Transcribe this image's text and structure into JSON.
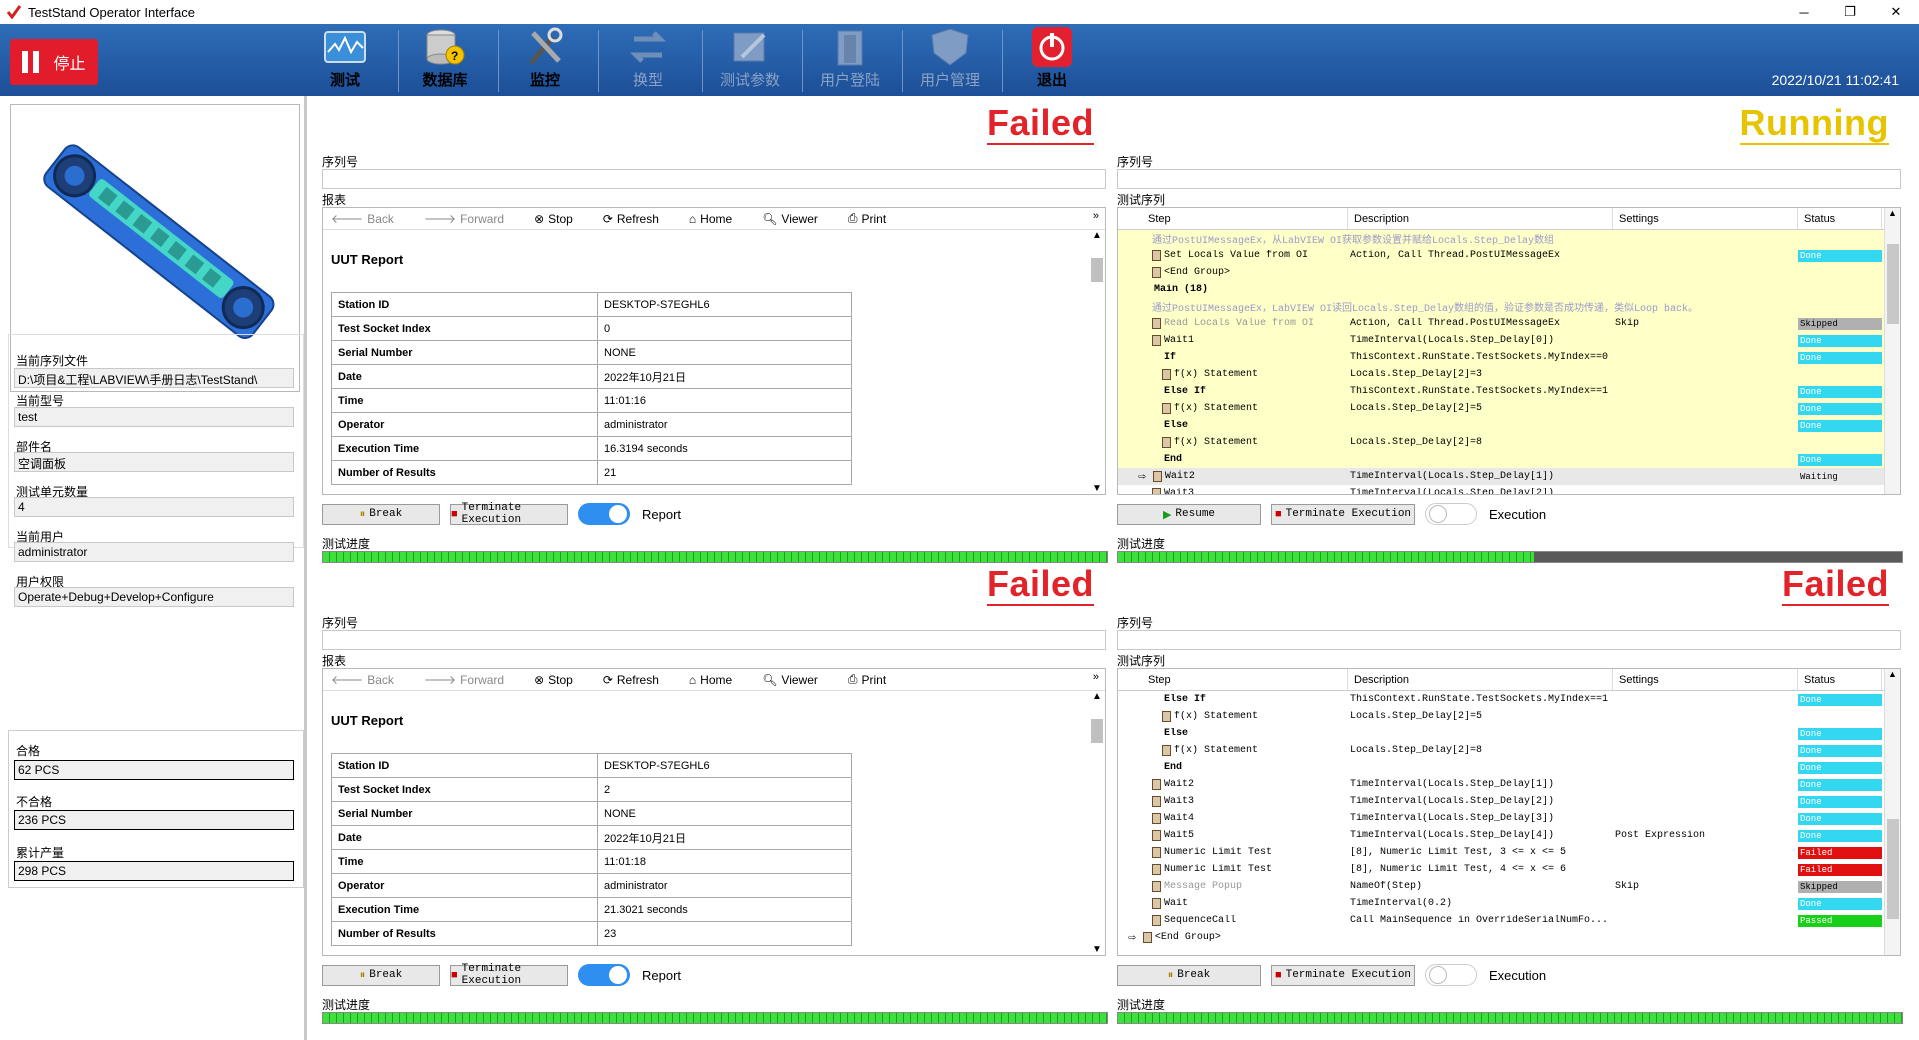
{
  "window": {
    "title": "TestStand Operator Interface",
    "min": "─",
    "max": "❐",
    "close": "✕"
  },
  "toolbar": {
    "stop": "停止",
    "items": [
      {
        "label": "测试",
        "enabled": true
      },
      {
        "label": "数据库",
        "enabled": true
      },
      {
        "label": "监控",
        "enabled": true
      },
      {
        "label": "换型",
        "enabled": false
      },
      {
        "label": "测试参数",
        "enabled": false
      },
      {
        "label": "用户登陆",
        "enabled": false
      },
      {
        "label": "用户管理",
        "enabled": false
      },
      {
        "label": "退出",
        "enabled": true
      }
    ],
    "datetime": "2022/10/21 11:02:41"
  },
  "left": {
    "seq_file_label": "当前序列文件",
    "seq_file": "D:\\项目&工程\\LABVIEW\\手册日志\\TestStand\\",
    "model_label": "当前型号",
    "model": "test",
    "part_label": "部件名",
    "part": "空调面板",
    "units_label": "测试单元数量",
    "units": "4",
    "user_label": "当前用户",
    "user": "administrator",
    "priv_label": "用户权限",
    "priv": "Operate+Debug+Develop+Configure",
    "pass_label": "合格",
    "pass": "62 PCS",
    "fail_label": "不合格",
    "fail": "236 PCS",
    "total_label": "累计产量",
    "total": "298 PCS"
  },
  "common": {
    "serial_label": "序列号",
    "report_label": "报表",
    "seq_label": "测试序列",
    "progress_label": "测试进度",
    "back": "Back",
    "forward": "Forward",
    "stop": "Stop",
    "refresh": "Refresh",
    "home": "Home",
    "viewer": "Viewer",
    "print": "Print",
    "break": "Break",
    "resume": "Resume",
    "terminate": "Terminate Execution",
    "report_toggle": "Report",
    "exec_toggle": "Execution",
    "uut_report": "UUT Report",
    "col_step": "Step",
    "col_desc": "Description",
    "col_settings": "Settings",
    "col_status": "Status"
  },
  "sockets": [
    {
      "status": "Failed",
      "progress": 1.0,
      "report": [
        [
          "Station ID",
          "DESKTOP-S7EGHL6"
        ],
        [
          "Test Socket Index",
          "0"
        ],
        [
          "Serial Number",
          "NONE"
        ],
        [
          "Date",
          "2022年10月21日"
        ],
        [
          "Time",
          "11:01:16"
        ],
        [
          "Operator",
          "administrator"
        ],
        [
          "Execution Time",
          "16.3194 seconds"
        ],
        [
          "Number of Results",
          "21"
        ]
      ]
    },
    {
      "status": "Running",
      "progress": 0.53
    },
    {
      "status": "Failed",
      "progress": 1.0,
      "report": [
        [
          "Station ID",
          "DESKTOP-S7EGHL6"
        ],
        [
          "Test Socket Index",
          "2"
        ],
        [
          "Serial Number",
          "NONE"
        ],
        [
          "Date",
          "2022年10月21日"
        ],
        [
          "Time",
          "11:01:18"
        ],
        [
          "Operator",
          "administrator"
        ],
        [
          "Execution Time",
          "21.3021 seconds"
        ],
        [
          "Number of Results",
          "23"
        ]
      ]
    },
    {
      "status": "Failed",
      "progress": 1.0
    }
  ],
  "seq2": [
    {
      "step": "通过PostUIMessageEx，从LabVIEW OI获取参数设置并赋给Locals.Step_Delay数组",
      "desc": "",
      "set": "",
      "status": "",
      "cls": "comment yel",
      "ind": 2
    },
    {
      "step": "Set Locals Value from OI",
      "desc": "Action,  Call Thread.PostUIMessageEx",
      "set": "",
      "status": "Done",
      "cls": "yel",
      "ind": 2
    },
    {
      "step": "<End Group>",
      "desc": "",
      "set": "",
      "status": "",
      "cls": "yel",
      "ind": 2
    },
    {
      "step": "Main (18)",
      "desc": "",
      "set": "",
      "status": "",
      "cls": "yel",
      "ind": 1,
      "bold": true
    },
    {
      "step": "通过PostUIMessageEx，LabVIEW OI读回Locals.Step_Delay数组的值，验证参数是否成功传递，类似Loop back。",
      "desc": "",
      "set": "",
      "status": "",
      "cls": "comment yel",
      "ind": 2
    },
    {
      "step": "Read Locals Value from OI",
      "desc": "Action,  Call Thread.PostUIMessageEx",
      "set": "Skip",
      "status": "Skipped",
      "cls": "yel",
      "ind": 2,
      "dim": true
    },
    {
      "step": "Wait1",
      "desc": "TimeInterval(Locals.Step_Delay[0])",
      "set": "",
      "status": "Done",
      "cls": "yel",
      "ind": 2
    },
    {
      "step": "If",
      "desc": "ThisContext.RunState.TestSockets.MyIndex==0",
      "set": "",
      "status": "Done",
      "cls": "yel",
      "ind": 2,
      "bold": true
    },
    {
      "step": "f(x) Statement",
      "desc": "Locals.Step_Delay[2]=3",
      "set": "",
      "status": "",
      "cls": "yel",
      "ind": 3
    },
    {
      "step": "Else If",
      "desc": "ThisContext.RunState.TestSockets.MyIndex==1",
      "set": "",
      "status": "Done",
      "cls": "yel",
      "ind": 2,
      "bold": true
    },
    {
      "step": "f(x) Statement",
      "desc": "Locals.Step_Delay[2]=5",
      "set": "",
      "status": "Done",
      "cls": "yel",
      "ind": 3
    },
    {
      "step": "Else",
      "desc": "",
      "set": "",
      "status": "Done",
      "cls": "yel",
      "ind": 2,
      "bold": true
    },
    {
      "step": "f(x) Statement",
      "desc": "Locals.Step_Delay[2]=8",
      "set": "",
      "status": "",
      "cls": "yel",
      "ind": 3
    },
    {
      "step": "End",
      "desc": "",
      "set": "",
      "status": "Done",
      "cls": "yel",
      "ind": 2,
      "bold": true
    },
    {
      "step": "Wait2",
      "desc": "TimeInterval(Locals.Step_Delay[1])",
      "set": "",
      "status": "Waiting",
      "cls": "sel",
      "ind": 2,
      "arrow": true
    },
    {
      "step": "Wait3",
      "desc": "TimeInterval(Locals.Step_Delay[2])",
      "set": "",
      "status": "",
      "cls": "",
      "ind": 2
    }
  ],
  "seq4": [
    {
      "step": "Else If",
      "desc": "ThisContext.RunState.TestSockets.MyIndex==1",
      "set": "",
      "status": "Done",
      "ind": 2,
      "bold": true
    },
    {
      "step": "f(x) Statement",
      "desc": "Locals.Step_Delay[2]=5",
      "set": "",
      "status": "",
      "ind": 3
    },
    {
      "step": "Else",
      "desc": "",
      "set": "",
      "status": "Done",
      "ind": 2,
      "bold": true
    },
    {
      "step": "f(x) Statement",
      "desc": "Locals.Step_Delay[2]=8",
      "set": "",
      "status": "Done",
      "ind": 3
    },
    {
      "step": "End",
      "desc": "",
      "set": "",
      "status": "Done",
      "ind": 2,
      "bold": true
    },
    {
      "step": "Wait2",
      "desc": "TimeInterval(Locals.Step_Delay[1])",
      "set": "",
      "status": "Done",
      "ind": 2
    },
    {
      "step": "Wait3",
      "desc": "TimeInterval(Locals.Step_Delay[2])",
      "set": "",
      "status": "Done",
      "ind": 2
    },
    {
      "step": "Wait4",
      "desc": "TimeInterval(Locals.Step_Delay[3])",
      "set": "",
      "status": "Done",
      "ind": 2
    },
    {
      "step": "Wait5",
      "desc": "TimeInterval(Locals.Step_Delay[4])",
      "set": "Post Expression",
      "status": "Done",
      "ind": 2
    },
    {
      "step": "Numeric Limit Test",
      "desc": "[8], Numeric Limit Test,  3 <= x <= 5",
      "set": "",
      "status": "Failed",
      "ind": 2
    },
    {
      "step": "Numeric Limit Test",
      "desc": "[8], Numeric Limit Test,  4 <= x <= 6",
      "set": "",
      "status": "Failed",
      "ind": 2
    },
    {
      "step": "Message Popup",
      "desc": "NameOf(Step)",
      "set": "Skip",
      "status": "Skipped",
      "ind": 2,
      "dim": true
    },
    {
      "step": "Wait",
      "desc": "TimeInterval(0.2)",
      "set": "",
      "status": "Done",
      "ind": 2
    },
    {
      "step": "SequenceCall",
      "desc": "Call MainSequence in OverrideSerialNumFo...",
      "set": "",
      "status": "Passed",
      "ind": 2
    },
    {
      "step": "<End Group>",
      "desc": "",
      "set": "",
      "status": "",
      "ind": 1,
      "arrow": true
    }
  ],
  "colors": {
    "failed": "#e2232a",
    "running": "#e6c400",
    "done": "#33d7ef",
    "passed": "#18d018"
  }
}
